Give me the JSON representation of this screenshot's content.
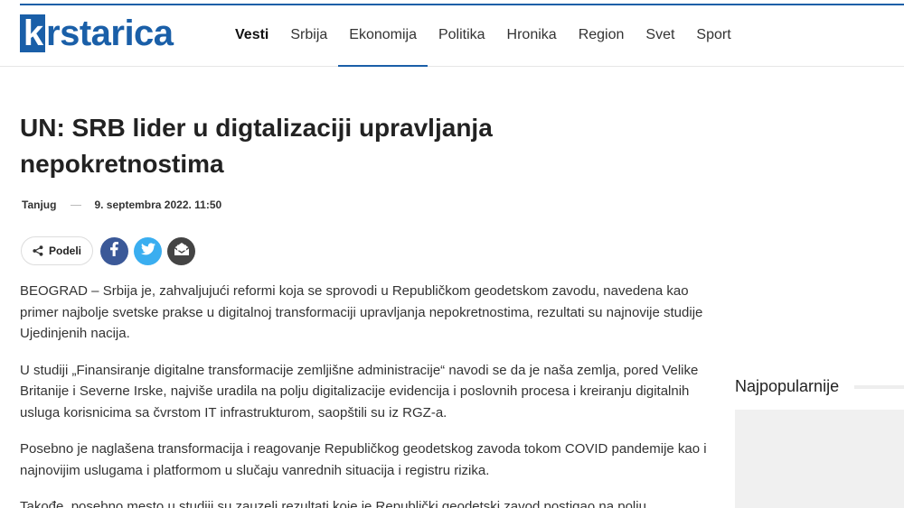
{
  "header": {
    "logo_k": "k",
    "logo_rest": "rstarica",
    "nav": [
      {
        "label": "Vesti"
      },
      {
        "label": "Srbija"
      },
      {
        "label": "Ekonomija"
      },
      {
        "label": "Politika"
      },
      {
        "label": "Hronika"
      },
      {
        "label": "Region"
      },
      {
        "label": "Svet"
      },
      {
        "label": "Sport"
      }
    ],
    "active_nav": "Ekonomija"
  },
  "article": {
    "title": "UN: SRB lider u digtalizaciji upravljanja nepokretnostima",
    "source": "Tanjug",
    "date": "9. septembra 2022. 11:50",
    "share_label": "Podeli",
    "paragraphs": [
      "BEOGRAD – Srbija je, zahvaljujući reformi koja se sprovodi u Republičkom geodetskom zavodu, navedena kao primer najbolje svetske prakse u digitalnoj transformaciji upravljanja nepokretnostima, rezultati su najnovije studije Ujedinjenih nacija.",
      "U studiji „Finansiranje digitalne transformacije zemljišne administracije“ navodi se da je naša zemlja, pored Velike Britanije i Severne Irske, najviše uradila na polju digitalizacije evidencija i poslovnih procesa i kreiranju digitalnih usluga korisnicima sa čvrstom IT infrastrukturom, saopštili su iz RGZ-a.",
      "Posebno je naglašena transformacija i reagovanje Republičkog geodetskog zavoda tokom COVID pandemije kao i najnovijim uslugama i platformom u slučaju vanrednih situacija i registru rizika.",
      "Takođe, posebno mesto u studiji su zauzeli rezultati koje je Republički geodetski zavod postigao na polju"
    ]
  },
  "sidebar": {
    "popular_title": "Najpopularnije"
  },
  "colors": {
    "brand": "#1a5fa8",
    "facebook": "#3b5998",
    "twitter": "#3aaef0",
    "email": "#444444"
  },
  "icons": {
    "share": "share-icon",
    "facebook": "facebook-icon",
    "twitter": "twitter-icon",
    "email": "email-icon"
  }
}
